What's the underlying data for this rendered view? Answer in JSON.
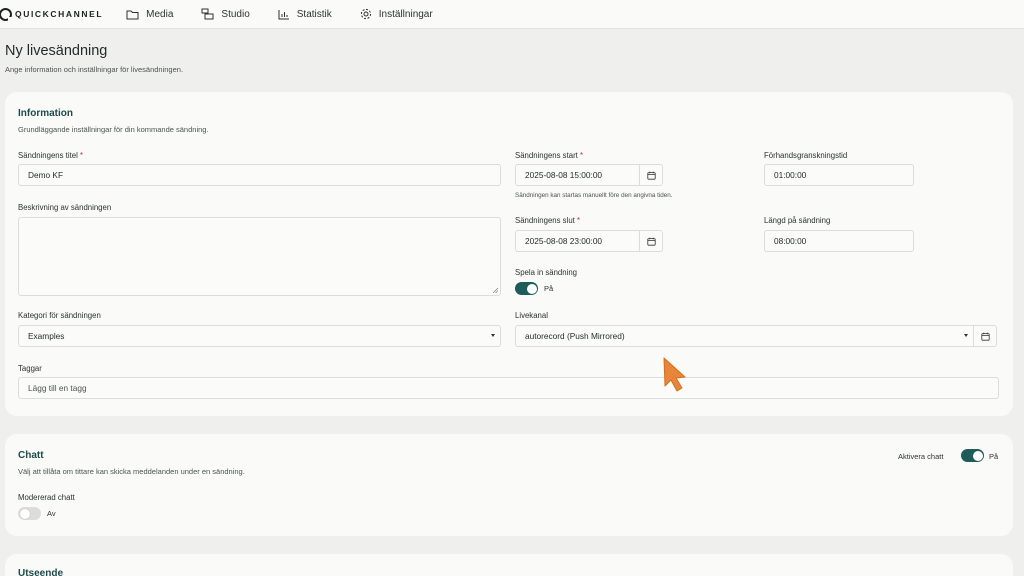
{
  "brand": {
    "name": "QUICKCHANNEL"
  },
  "nav": [
    {
      "label": "Media",
      "icon": "folder-icon"
    },
    {
      "label": "Studio",
      "icon": "studio-icon"
    },
    {
      "label": "Statistik",
      "icon": "chart-icon"
    },
    {
      "label": "Inställningar",
      "icon": "gear-icon"
    }
  ],
  "page": {
    "title": "Ny livesändning",
    "subtitle": "Ange information och inställningar för livesändningen."
  },
  "information": {
    "title": "Information",
    "subtitle": "Grundläggande inställningar för din kommande sändning.",
    "title_field": {
      "label": "Sändningens titel",
      "required": "*",
      "value": "Demo KF"
    },
    "description": {
      "label": "Beskrivning av sändningen",
      "value": ""
    },
    "category": {
      "label": "Kategori för sändningen",
      "value": "Examples"
    },
    "tags": {
      "label": "Taggar",
      "placeholder": "Lägg till en tagg"
    },
    "start": {
      "label": "Sändningens start",
      "required": "*",
      "value": "2025-08-08 15:00:00",
      "hint": "Sändningen kan startas manuellt före den angivna tiden."
    },
    "end": {
      "label": "Sändningens slut",
      "required": "*",
      "value": "2025-08-08 23:00:00"
    },
    "preview": {
      "label": "Förhandsgranskningstid",
      "value": "01:00:00"
    },
    "length": {
      "label": "Längd på sändning",
      "value": "08:00:00"
    },
    "record": {
      "label": "Spela in sändning",
      "state": "På",
      "on": true
    },
    "channel": {
      "label": "Livekanal",
      "value": "autorecord (Push Mirrored)"
    }
  },
  "chat": {
    "title": "Chatt",
    "subtitle": "Välj att tillåta om tittare kan skicka meddelanden under en sändning.",
    "enable": {
      "label": "Aktivera chatt",
      "state": "På",
      "on": true
    },
    "moderated": {
      "label": "Modererad chatt",
      "state": "Av",
      "on": false
    }
  },
  "appearance": {
    "title": "Utseende"
  },
  "colors": {
    "accent": "#1f5b59",
    "heading": "#1d4a4a",
    "cursor": "#e8853b"
  }
}
